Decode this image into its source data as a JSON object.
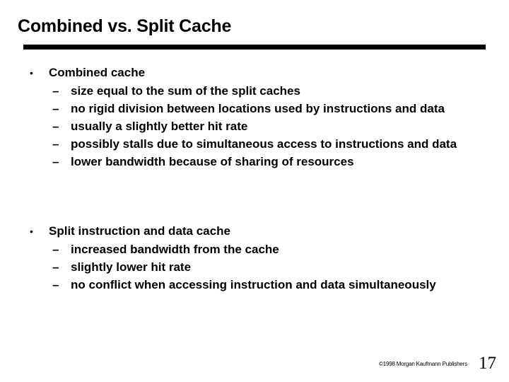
{
  "slide": {
    "title": "Combined vs. Split Cache",
    "sections": [
      {
        "marker": "•",
        "heading": "Combined cache",
        "items": [
          "size equal to the sum of the split caches",
          "no rigid division between locations used by instructions and data",
          "usually a slightly better hit rate",
          "possibly stalls due to simultaneous access to instructions and data",
          "lower bandwidth because of sharing of resources"
        ]
      },
      {
        "marker": "•",
        "heading": "Split instruction and data cache",
        "items": [
          "increased bandwidth from the cache",
          "slightly lower hit rate",
          "no conflict when accessing instruction and data simultaneously"
        ]
      }
    ],
    "sub_marker": "–"
  },
  "footer": {
    "copyright": "©1998 Morgan Kaufmann Publishers",
    "page_number": "17"
  }
}
